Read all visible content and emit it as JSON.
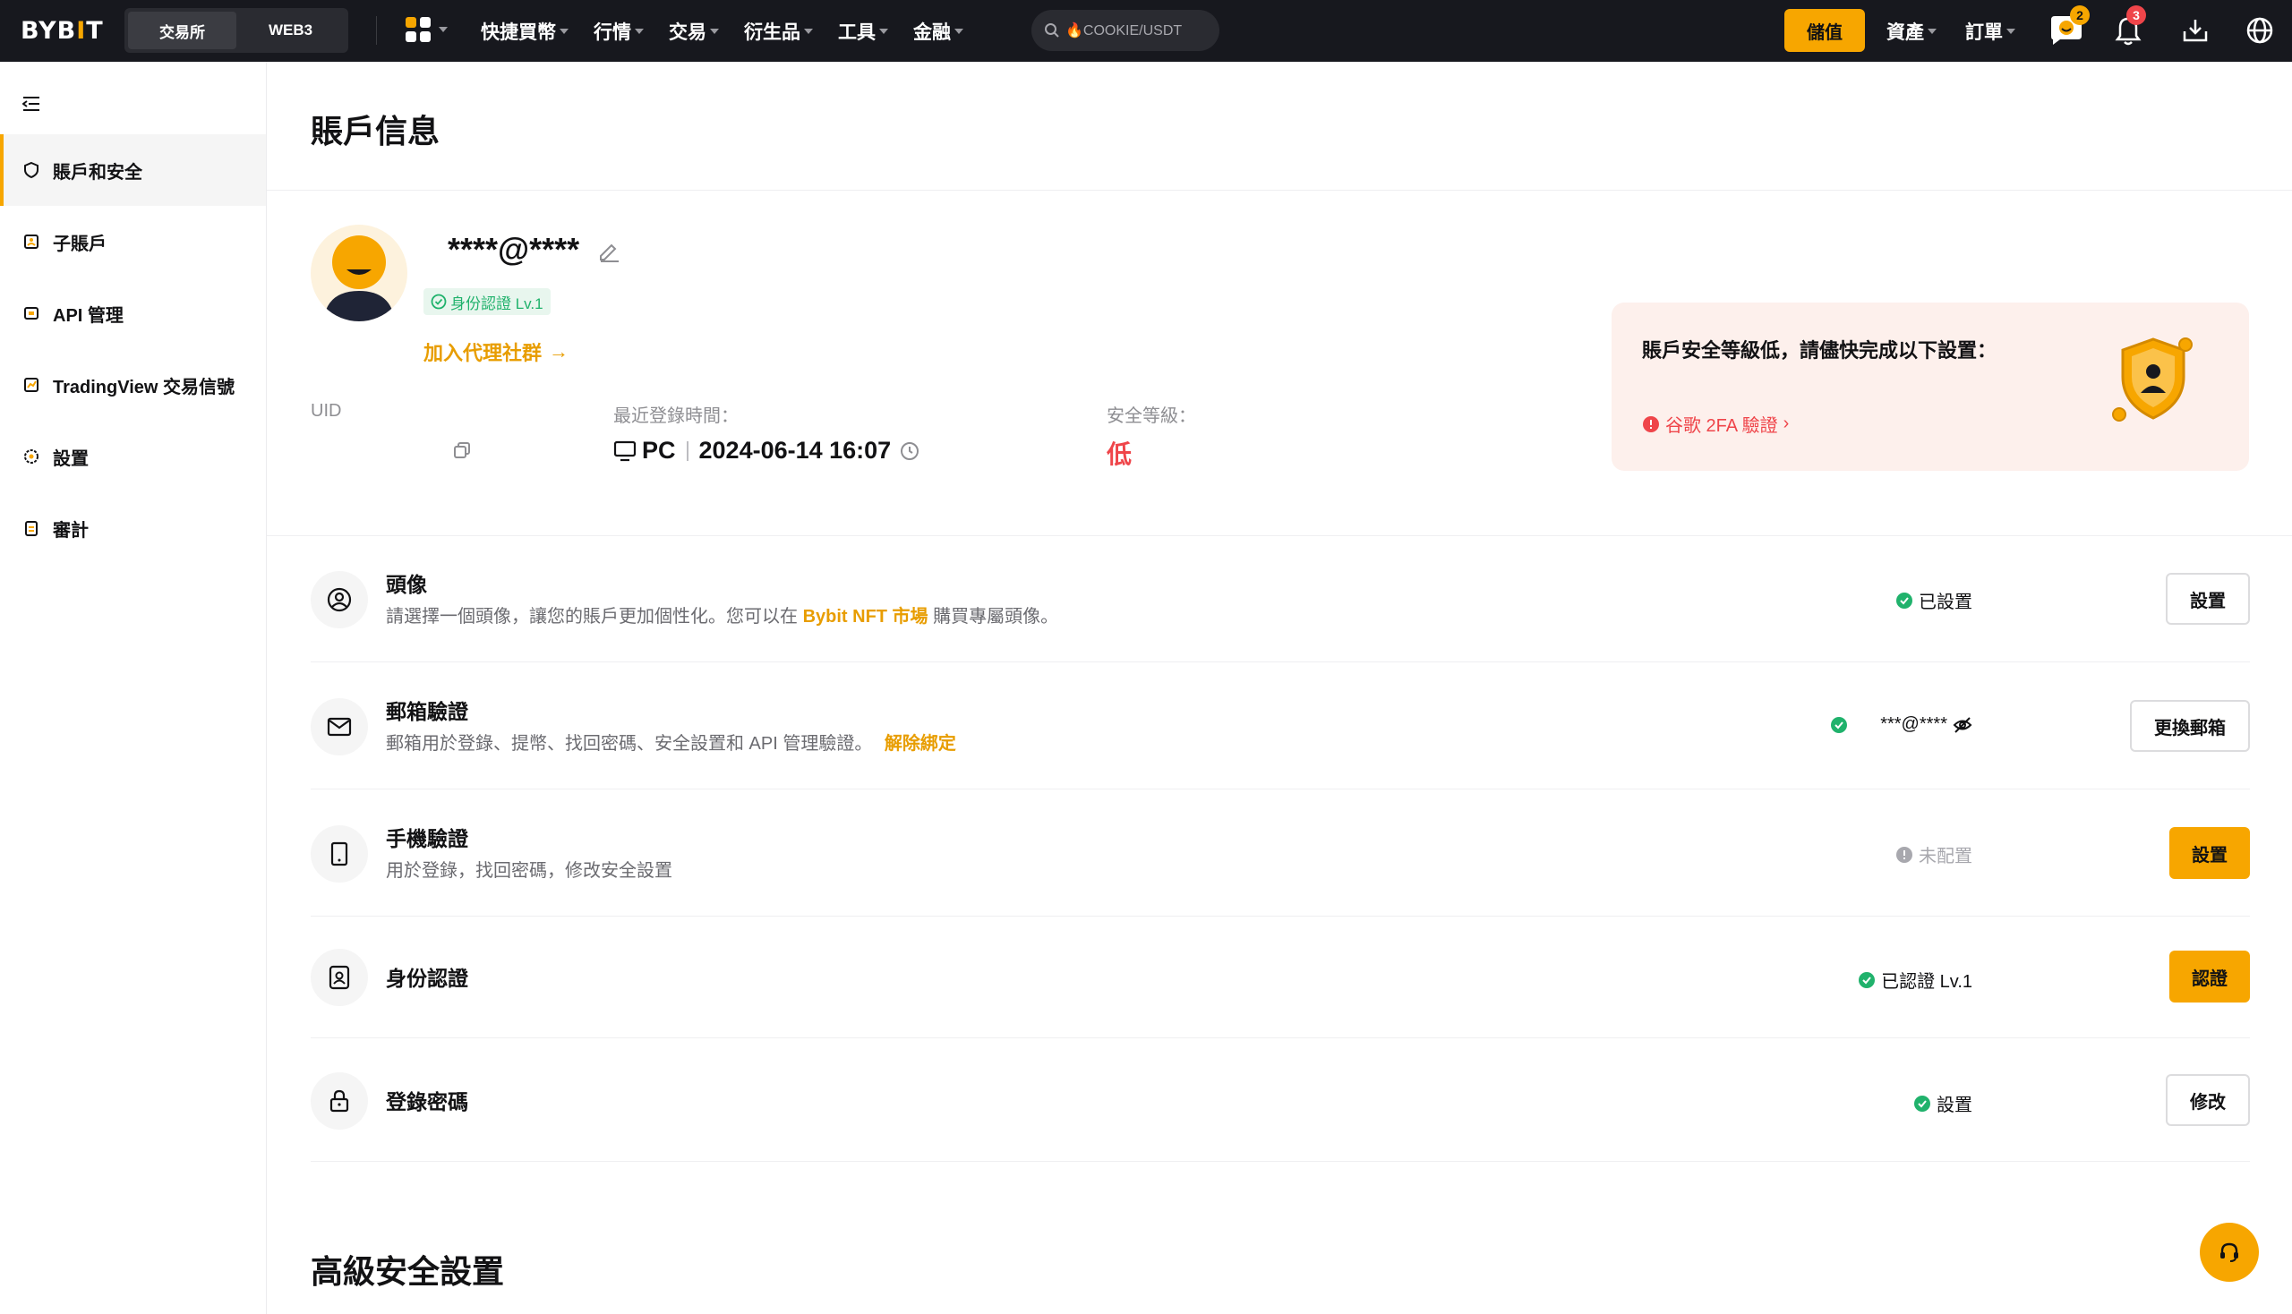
{
  "brand": {
    "logo_left": "BYB",
    "logo_dot": "I",
    "logo_right": "T",
    "accent": "#f7a600"
  },
  "topnav": {
    "exchange_tab": "交易所",
    "web3_tab": "WEB3",
    "menu": [
      "快捷買幣",
      "行情",
      "交易",
      "衍生品",
      "工具",
      "金融"
    ],
    "search_placeholder": "🔥COOKIE/USDT",
    "deposit": "儲值",
    "right_menu": [
      "資產",
      "訂單"
    ],
    "chat_badge": "2",
    "notify_badge": "3"
  },
  "sidebar": {
    "items": [
      {
        "label": "賬戶和安全",
        "icon": "shield-icon"
      },
      {
        "label": "子賬戶",
        "icon": "subaccount-icon"
      },
      {
        "label": "API 管理",
        "icon": "api-icon"
      },
      {
        "label": "TradingView 交易信號",
        "icon": "chart-icon"
      },
      {
        "label": "設置",
        "icon": "gear-icon"
      },
      {
        "label": "審計",
        "icon": "clipboard-icon"
      }
    ]
  },
  "page": {
    "title": "賬戶信息"
  },
  "profile": {
    "username": "****@****",
    "kyc_badge": "身份認證 Lv.1",
    "join_link": "加入代理社群",
    "uid_label": "UID",
    "uid_value": "",
    "login_label": "最近登錄時間：",
    "login_device": "PC",
    "login_time": "2024-06-14 16:07",
    "level_label": "安全等級：",
    "level_value": "低"
  },
  "warning": {
    "title": "賬戶安全等級低，請儘快完成以下設置：",
    "link": "谷歌 2FA 驗證"
  },
  "rows": [
    {
      "title": "頭像",
      "desc_prefix": "請選擇一個頭像，讓您的賬戶更加個性化。您可以在",
      "desc_link": "Bybit NFT 市場",
      "desc_suffix": "購買專屬頭像。",
      "status": "已設置",
      "button": "設置",
      "icon": "avatar-icon"
    },
    {
      "title": "郵箱驗證",
      "desc_prefix": "郵箱用於登錄、提幣、找回密碼、安全設置和 API 管理驗證。",
      "desc_link": "解除綁定",
      "desc_suffix": "",
      "status": "***@****",
      "button": "更換郵箱",
      "icon": "mail-icon"
    },
    {
      "title": "手機驗證",
      "desc_prefix": "用於登錄，找回密碼，修改安全設置",
      "desc_link": "",
      "desc_suffix": "",
      "status": "未配置",
      "button": "設置",
      "icon": "phone-icon"
    },
    {
      "title": "身份認證",
      "desc_prefix": "",
      "desc_link": "",
      "desc_suffix": "",
      "status": "已認證 Lv.1",
      "button": "認證",
      "icon": "id-icon"
    },
    {
      "title": "登錄密碼",
      "desc_prefix": "",
      "desc_link": "",
      "desc_suffix": "",
      "status": "設置",
      "button": "修改",
      "icon": "lock-icon"
    }
  ],
  "advanced": {
    "title": "高級安全設置"
  }
}
